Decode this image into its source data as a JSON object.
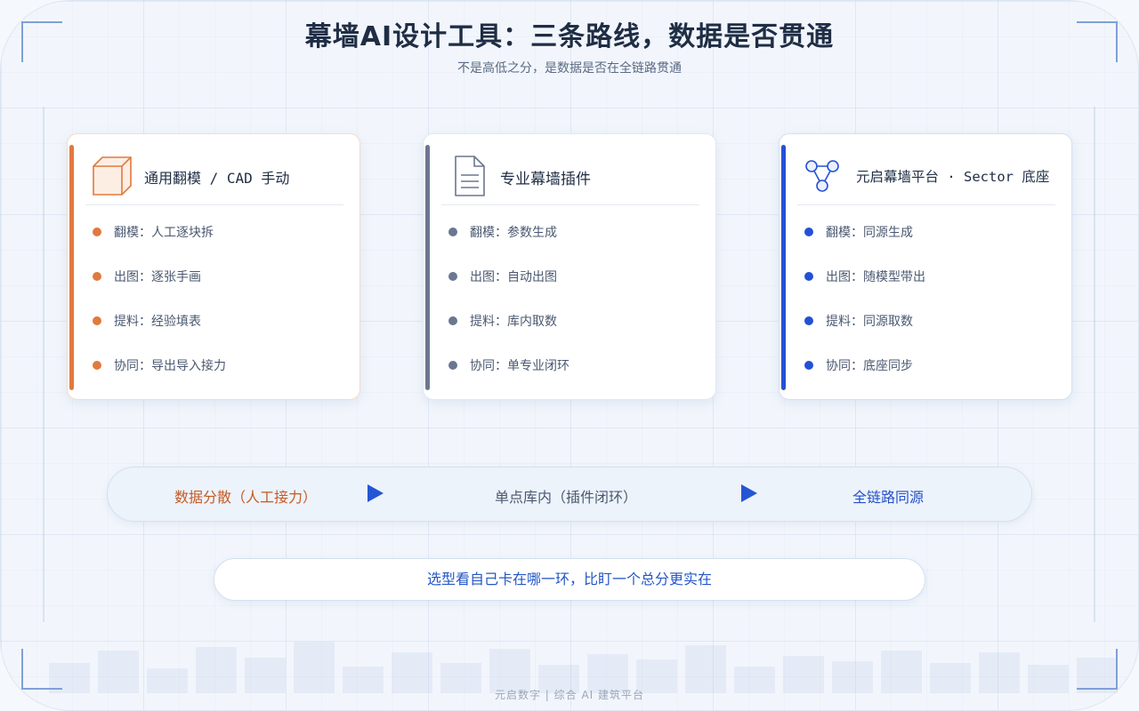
{
  "title": "幕墙AI设计工具：三条路线，数据是否贯通",
  "subtitle": "不是高低之分，是数据是否在全链路贯通",
  "colors": {
    "orange": "#e07a3e",
    "slate": "#6b7690",
    "blue": "#2450d6"
  },
  "cards": [
    {
      "title": "通用翻模 / CAD 手动",
      "icon": "cube-icon",
      "accent": "#e07a3e",
      "items": [
        "翻模：人工逐块拆",
        "出图：逐张手画",
        "提料：经验填表",
        "协同：导出导入接力"
      ]
    },
    {
      "title": "专业幕墙插件",
      "icon": "document-icon",
      "accent": "#6b7690",
      "items": [
        "翻模：参数生成",
        "出图：自动出图",
        "提料：库内取数",
        "协同：单专业闭环"
      ]
    },
    {
      "title": "元启幕墙平台 · Sector 底座",
      "icon": "network-triangle-icon",
      "accent": "#2450d6",
      "items": [
        "翻模：同源生成",
        "出图：随模型带出",
        "提料：同源取数",
        "协同：底座同步"
      ]
    }
  ],
  "flow": {
    "stages": [
      "数据分散（人工接力）",
      "单点库内（插件闭环）",
      "全链路同源"
    ],
    "arrow_icon": "play-arrow-icon"
  },
  "note": "选型看自己卡在哪一环，比盯一个总分更实在",
  "footer": "元启数字 | 综合 AI 建筑平台"
}
